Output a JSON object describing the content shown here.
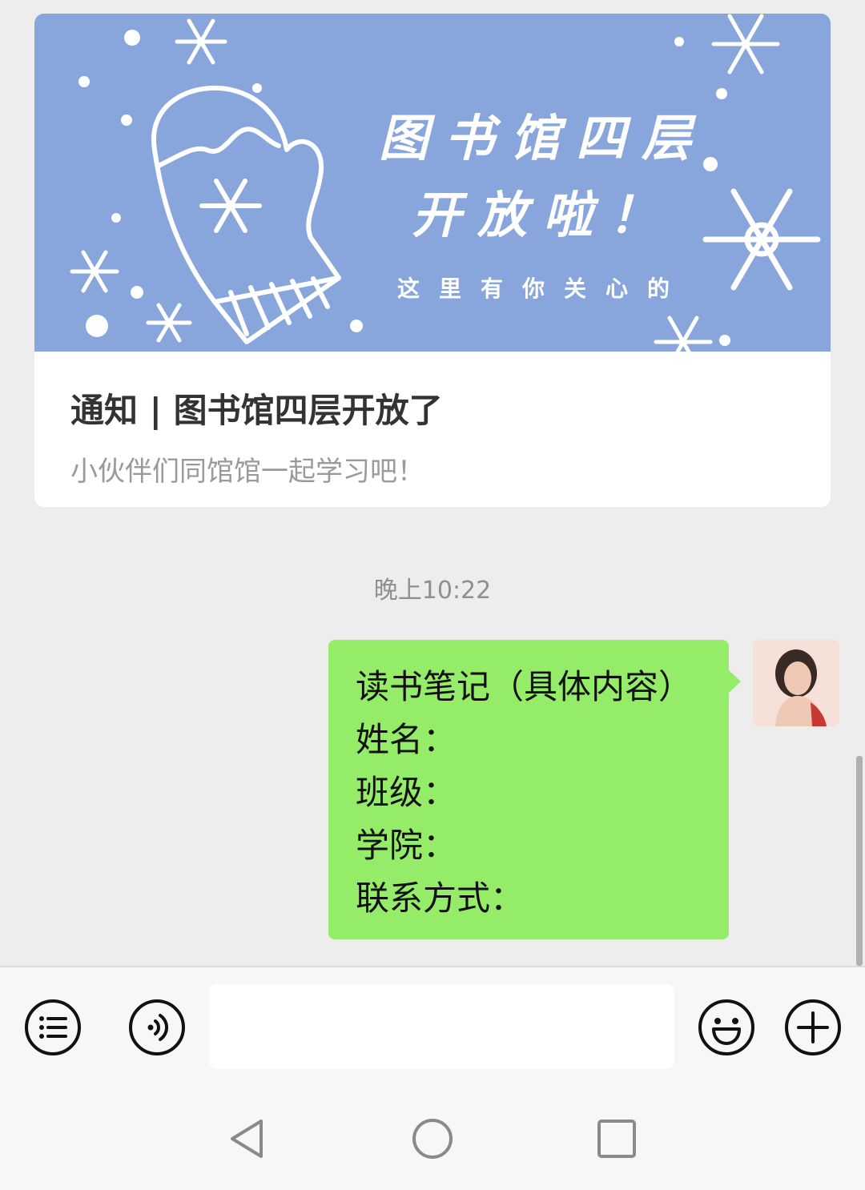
{
  "article": {
    "cover_title_line1": "图书馆四层",
    "cover_title_line2": "开放啦！",
    "cover_subtitle": "这里有你关心的",
    "title": "通知 | 图书馆四层开放了",
    "description": "小伙伴们同馆馆一起学习吧！",
    "cover_color": "#88a6dc"
  },
  "timestamp": "晚上10:22",
  "message": {
    "lines": [
      "读书笔记（具体内容）",
      "姓名：",
      "班级：",
      "学院：",
      "联系方式："
    ],
    "bubble_color": "#95ec69"
  },
  "input_bar": {
    "menu_icon": "list-menu-icon",
    "voice_icon": "voice-icon",
    "text_value": "",
    "emoji_icon": "emoji-icon",
    "more_icon": "plus-icon"
  },
  "nav_bar": {
    "back_icon": "back-triangle-icon",
    "home_icon": "home-circle-icon",
    "recents_icon": "recents-square-icon"
  }
}
